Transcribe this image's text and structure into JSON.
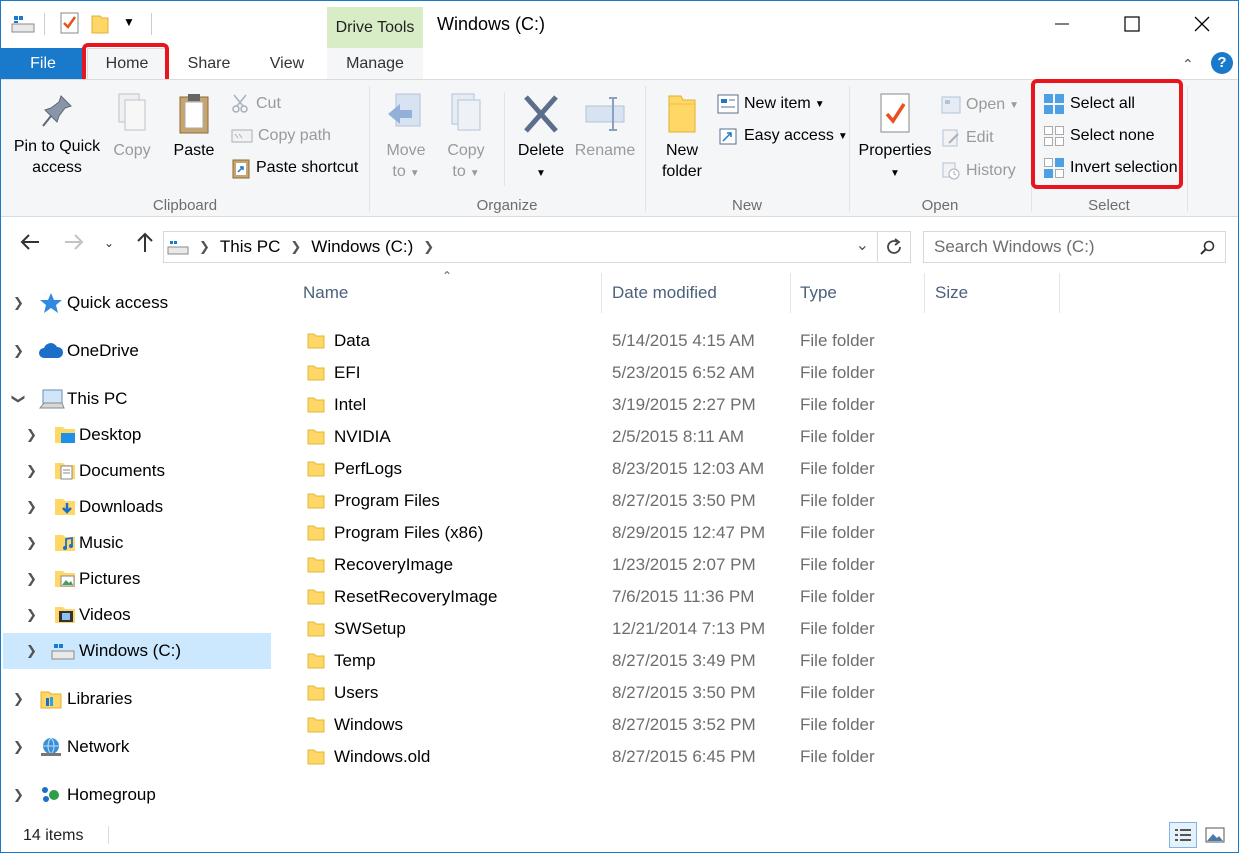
{
  "window": {
    "title": "Windows (C:)",
    "context_tab_group": "Drive Tools"
  },
  "tabs": {
    "file": "File",
    "home": "Home",
    "share": "Share",
    "view": "View",
    "manage": "Manage"
  },
  "ribbon": {
    "clipboard": {
      "label": "Clipboard",
      "pin_line1": "Pin to Quick",
      "pin_line2": "access",
      "copy": "Copy",
      "paste": "Paste",
      "cut": "Cut",
      "copy_path": "Copy path",
      "paste_shortcut": "Paste shortcut"
    },
    "organize": {
      "label": "Organize",
      "move_line1": "Move",
      "move_line2": "to",
      "copyto_line1": "Copy",
      "copyto_line2": "to",
      "delete": "Delete",
      "rename": "Rename"
    },
    "new": {
      "label": "New",
      "folder_line1": "New",
      "folder_line2": "folder",
      "new_item": "New item",
      "easy_access": "Easy access"
    },
    "open": {
      "label": "Open",
      "properties": "Properties",
      "open": "Open",
      "edit": "Edit",
      "history": "History"
    },
    "select": {
      "label": "Select",
      "select_all": "Select all",
      "select_none": "Select none",
      "invert": "Invert selection"
    }
  },
  "address": {
    "crumbs": [
      "This PC",
      "Windows (C:)"
    ],
    "search_placeholder": "Search Windows (C:)"
  },
  "nav": {
    "items": [
      {
        "label": "Quick access",
        "icon": "star-icon",
        "level": 0,
        "expanded": false
      },
      {
        "label": "OneDrive",
        "icon": "cloud-icon",
        "level": 0,
        "expanded": false
      },
      {
        "label": "This PC",
        "icon": "computer-icon",
        "level": 0,
        "expanded": true
      },
      {
        "label": "Desktop",
        "icon": "desktop-folder-icon",
        "level": 1,
        "expanded": false
      },
      {
        "label": "Documents",
        "icon": "documents-folder-icon",
        "level": 1,
        "expanded": false
      },
      {
        "label": "Downloads",
        "icon": "downloads-folder-icon",
        "level": 1,
        "expanded": false
      },
      {
        "label": "Music",
        "icon": "music-folder-icon",
        "level": 1,
        "expanded": false
      },
      {
        "label": "Pictures",
        "icon": "pictures-folder-icon",
        "level": 1,
        "expanded": false
      },
      {
        "label": "Videos",
        "icon": "videos-folder-icon",
        "level": 1,
        "expanded": false
      },
      {
        "label": "Windows (C:)",
        "icon": "drive-icon",
        "level": 1,
        "expanded": false,
        "selected": true
      },
      {
        "label": "Libraries",
        "icon": "libraries-icon",
        "level": 0,
        "expanded": false
      },
      {
        "label": "Network",
        "icon": "network-icon",
        "level": 0,
        "expanded": false
      },
      {
        "label": "Homegroup",
        "icon": "homegroup-icon",
        "level": 0,
        "expanded": false
      }
    ]
  },
  "columns": {
    "name": "Name",
    "date": "Date modified",
    "type": "Type",
    "size": "Size"
  },
  "files": [
    {
      "name": "Data",
      "date": "5/14/2015 4:15 AM",
      "type": "File folder"
    },
    {
      "name": "EFI",
      "date": "5/23/2015 6:52 AM",
      "type": "File folder"
    },
    {
      "name": "Intel",
      "date": "3/19/2015 2:27 PM",
      "type": "File folder"
    },
    {
      "name": "NVIDIA",
      "date": "2/5/2015 8:11 AM",
      "type": "File folder"
    },
    {
      "name": "PerfLogs",
      "date": "8/23/2015 12:03 AM",
      "type": "File folder"
    },
    {
      "name": "Program Files",
      "date": "8/27/2015 3:50 PM",
      "type": "File folder"
    },
    {
      "name": "Program Files (x86)",
      "date": "8/29/2015 12:47 PM",
      "type": "File folder"
    },
    {
      "name": "RecoveryImage",
      "date": "1/23/2015 2:07 PM",
      "type": "File folder"
    },
    {
      "name": "ResetRecoveryImage",
      "date": "7/6/2015 11:36 PM",
      "type": "File folder"
    },
    {
      "name": "SWSetup",
      "date": "12/21/2014 7:13 PM",
      "type": "File folder"
    },
    {
      "name": "Temp",
      "date": "8/27/2015 3:49 PM",
      "type": "File folder"
    },
    {
      "name": "Users",
      "date": "8/27/2015 3:50 PM",
      "type": "File folder"
    },
    {
      "name": "Windows",
      "date": "8/27/2015 3:52 PM",
      "type": "File folder"
    },
    {
      "name": "Windows.old",
      "date": "8/27/2015 6:45 PM",
      "type": "File folder"
    }
  ],
  "status": {
    "count": "14 items"
  },
  "colors": {
    "accent": "#1979ca",
    "highlight": "#e8141e",
    "folder": "#ffd767",
    "selected_bg": "#cce8ff"
  }
}
